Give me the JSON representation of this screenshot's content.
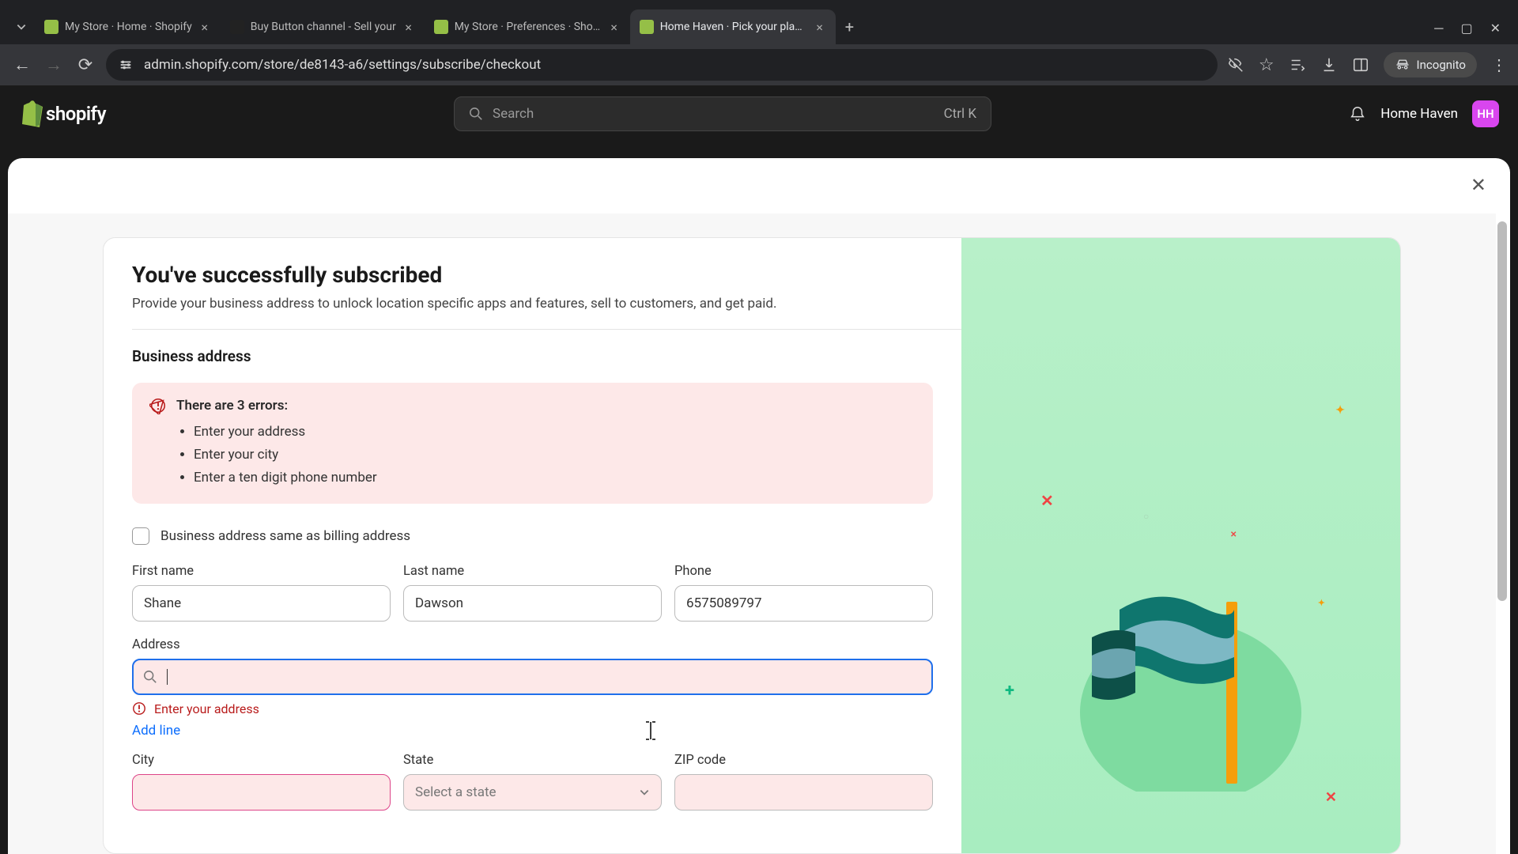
{
  "browser": {
    "tabs": [
      {
        "title": "My Store · Home · Shopify",
        "active": false,
        "favicon_color": "#95bf47"
      },
      {
        "title": "Buy Button channel - Sell your",
        "active": false,
        "favicon_color": "#222"
      },
      {
        "title": "My Store · Preferences · Shopify",
        "active": false,
        "favicon_color": "#95bf47"
      },
      {
        "title": "Home Haven · Pick your plan · S",
        "active": true,
        "favicon_color": "#95bf47"
      }
    ],
    "url": "admin.shopify.com/store/de8143-a6/settings/subscribe/checkout",
    "incognito_label": "Incognito"
  },
  "header": {
    "logo_text": "shopify",
    "search_placeholder": "Search",
    "search_kbd": "Ctrl K",
    "store_name": "Home Haven",
    "avatar_initials": "HH"
  },
  "page": {
    "title": "You've successfully subscribed",
    "subtitle": "Provide your business address to unlock location specific apps and features, sell to customers, and get paid."
  },
  "form": {
    "section_title": "Business address",
    "error_heading": "There are 3 errors:",
    "errors": [
      "Enter your address",
      "Enter your city",
      "Enter a ten digit phone number"
    ],
    "same_as_billing_label": "Business address same as billing address",
    "first_name_label": "First name",
    "first_name_value": "Shane",
    "last_name_label": "Last name",
    "last_name_value": "Dawson",
    "phone_label": "Phone",
    "phone_value": "6575089797",
    "address_label": "Address",
    "address_value": "",
    "address_error": "Enter your address",
    "add_line_label": "Add line",
    "city_label": "City",
    "state_label": "State",
    "state_placeholder": "Select a state",
    "zip_label": "ZIP code"
  }
}
